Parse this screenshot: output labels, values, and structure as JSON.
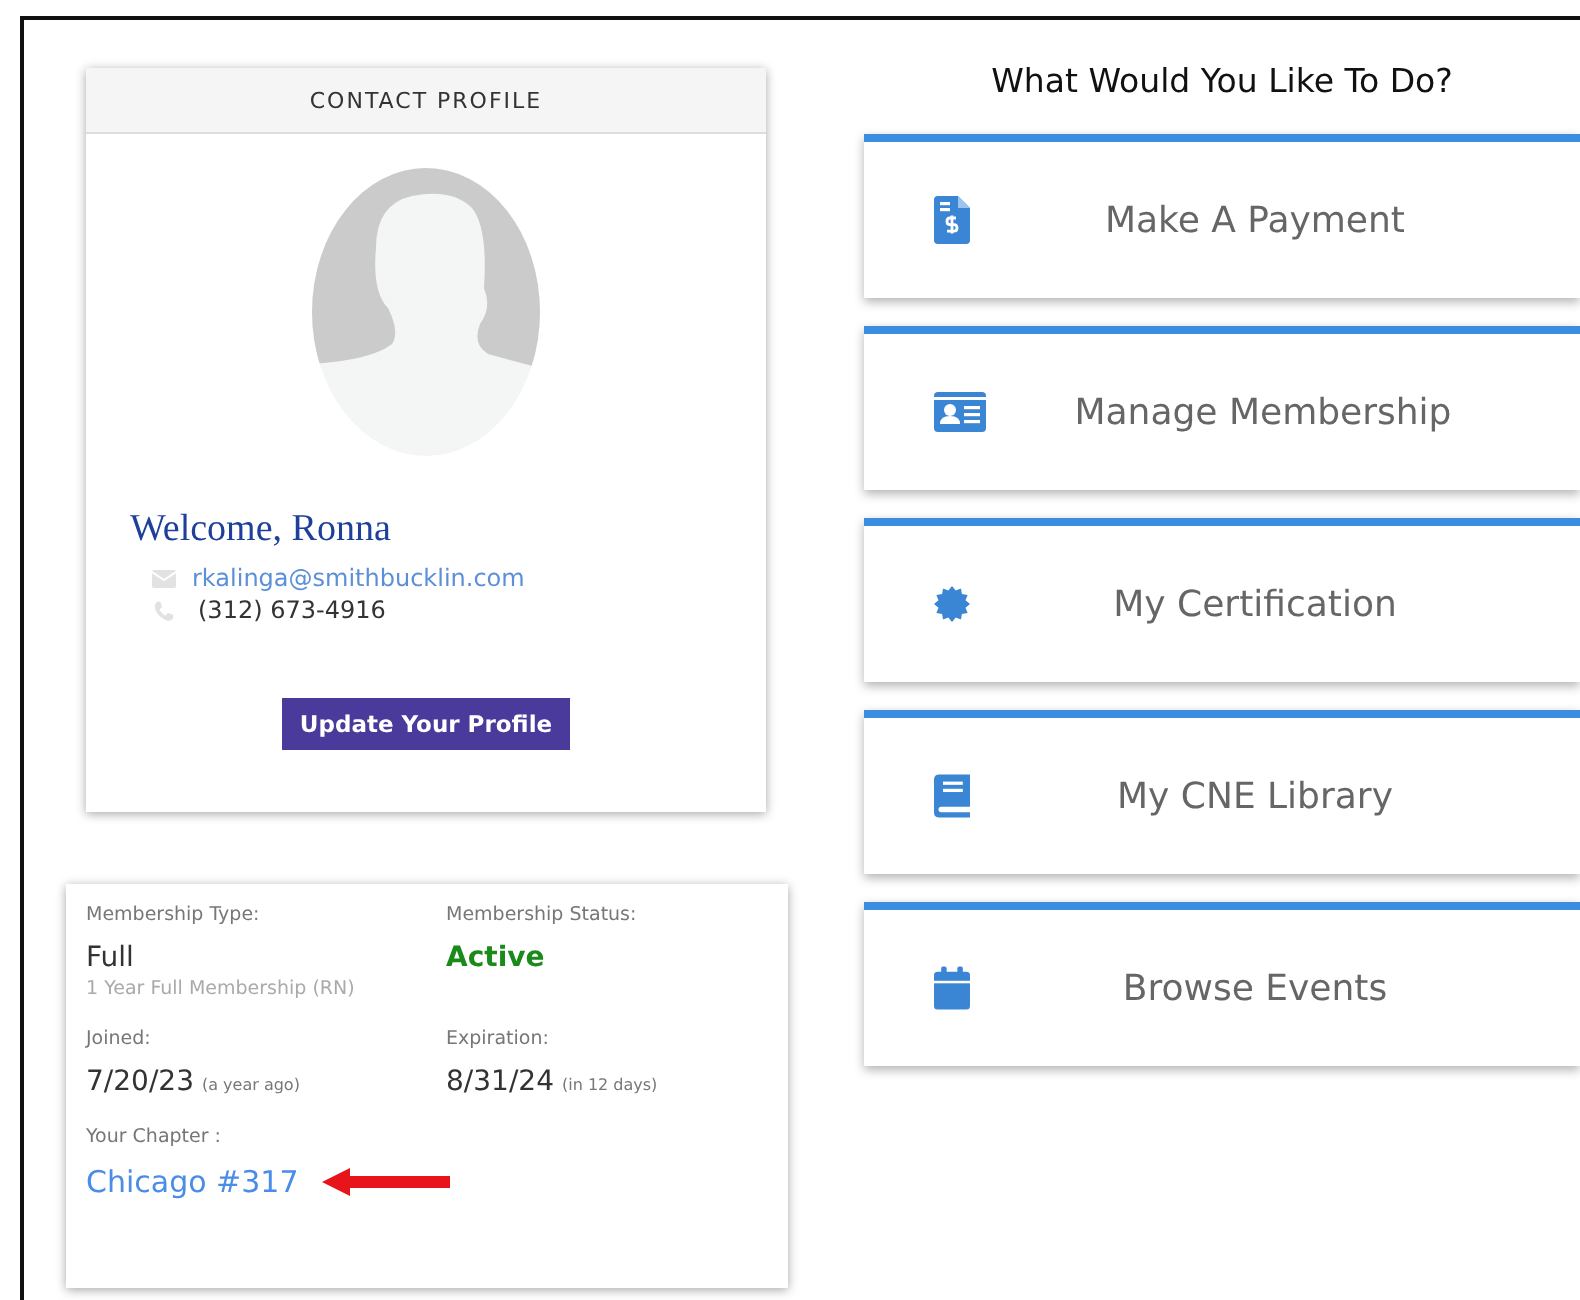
{
  "profile": {
    "header": "CONTACT PROFILE",
    "welcome": "Welcome, Ronna",
    "email": "rkalinga@smithbucklin.com",
    "phone": "(312) 673-4916",
    "button": "Update Your Profile"
  },
  "membership": {
    "type_label": "Membership Type:",
    "type_value": "Full",
    "type_detail": "1 Year Full Membership (RN)",
    "status_label": "Membership Status:",
    "status_value": "Active",
    "joined_label": "Joined:",
    "joined_value": "7/20/23",
    "joined_note": "(a year ago)",
    "expiration_label": "Expiration:",
    "expiration_value": "8/31/24",
    "expiration_note": "(in 12 days)",
    "chapter_label": "Your Chapter :",
    "chapter_value": "Chicago #317"
  },
  "actions": {
    "title": "What Would You Like To Do?",
    "items": [
      {
        "kind": "payment",
        "label": "Make A Payment"
      },
      {
        "kind": "membership",
        "label": "Manage Membership"
      },
      {
        "kind": "certification",
        "label": "My Certification"
      },
      {
        "kind": "library",
        "label": "My CNE Library"
      },
      {
        "kind": "events",
        "label": "Browse Events"
      }
    ]
  }
}
